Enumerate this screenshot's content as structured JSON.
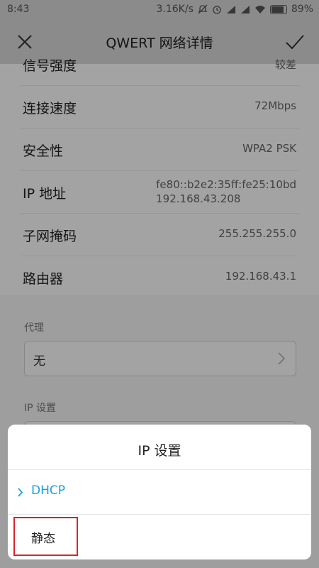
{
  "status_bar": {
    "time": "8:43",
    "net_speed": "3.16K/s",
    "battery": "89%",
    "battery_level": 0.89,
    "icons": [
      "mute-icon",
      "alarm-icon",
      "signal-icon",
      "signal-icon",
      "wifi-icon",
      "battery-icon"
    ]
  },
  "header": {
    "title": "QWERT  网络详情",
    "close_icon": "close-icon",
    "confirm_icon": "check-icon"
  },
  "details": [
    {
      "label": "信号强度",
      "value": "较差"
    },
    {
      "label": "连接速度",
      "value": "72Mbps"
    },
    {
      "label": "安全性",
      "value": "WPA2 PSK"
    },
    {
      "label": "IP 地址",
      "value": "fe80::b2e2:35ff:fe25:10bd",
      "value2": "192.168.43.208"
    },
    {
      "label": "子网掩码",
      "value": "255.255.255.0"
    },
    {
      "label": "路由器",
      "value": "192.168.43.1"
    }
  ],
  "proxy": {
    "section_label": "代理",
    "value": "无"
  },
  "ip_settings": {
    "section_label": "IP 设置"
  },
  "dialog": {
    "title": "IP  设置",
    "options": [
      {
        "label": "DHCP",
        "selected": true
      },
      {
        "label": "静态",
        "selected": false
      }
    ],
    "accent_color": "#1a9ee6",
    "highlight_color": "#d9232d"
  }
}
